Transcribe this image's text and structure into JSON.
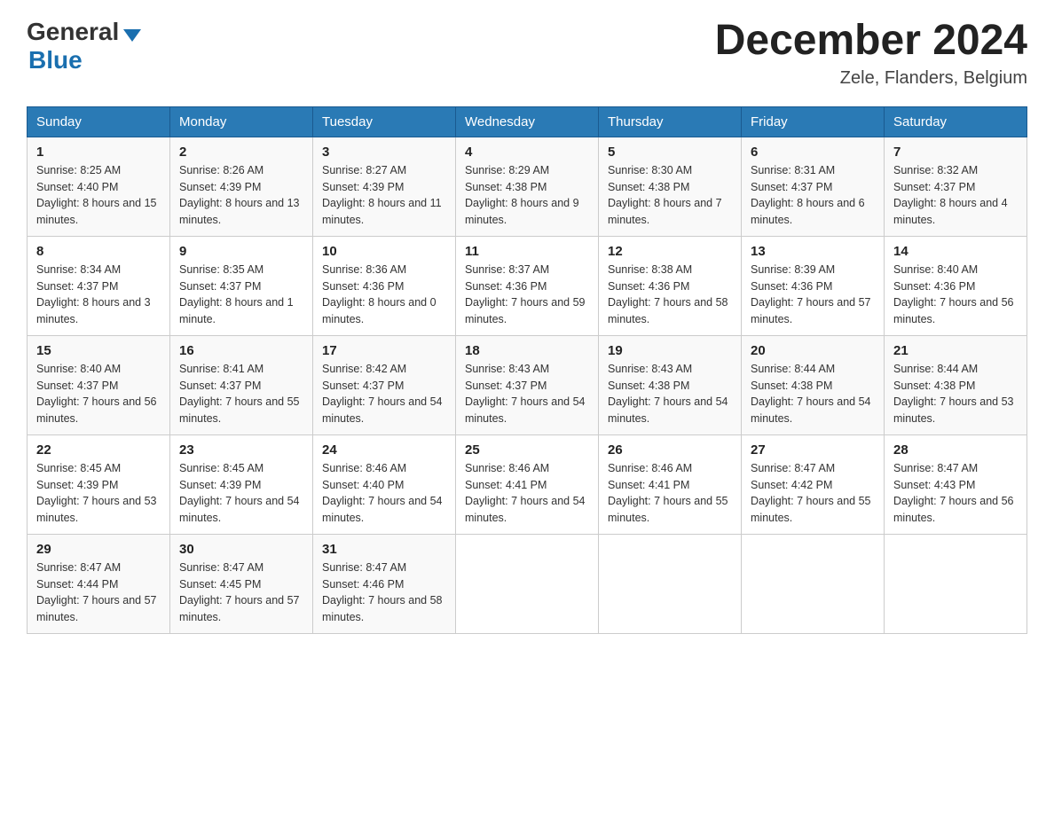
{
  "header": {
    "logo_general": "General",
    "logo_blue": "Blue",
    "month_year": "December 2024",
    "location": "Zele, Flanders, Belgium"
  },
  "days_of_week": [
    "Sunday",
    "Monday",
    "Tuesday",
    "Wednesday",
    "Thursday",
    "Friday",
    "Saturday"
  ],
  "weeks": [
    [
      {
        "day": "1",
        "sunrise": "8:25 AM",
        "sunset": "4:40 PM",
        "daylight": "8 hours and 15 minutes."
      },
      {
        "day": "2",
        "sunrise": "8:26 AM",
        "sunset": "4:39 PM",
        "daylight": "8 hours and 13 minutes."
      },
      {
        "day": "3",
        "sunrise": "8:27 AM",
        "sunset": "4:39 PM",
        "daylight": "8 hours and 11 minutes."
      },
      {
        "day": "4",
        "sunrise": "8:29 AM",
        "sunset": "4:38 PM",
        "daylight": "8 hours and 9 minutes."
      },
      {
        "day": "5",
        "sunrise": "8:30 AM",
        "sunset": "4:38 PM",
        "daylight": "8 hours and 7 minutes."
      },
      {
        "day": "6",
        "sunrise": "8:31 AM",
        "sunset": "4:37 PM",
        "daylight": "8 hours and 6 minutes."
      },
      {
        "day": "7",
        "sunrise": "8:32 AM",
        "sunset": "4:37 PM",
        "daylight": "8 hours and 4 minutes."
      }
    ],
    [
      {
        "day": "8",
        "sunrise": "8:34 AM",
        "sunset": "4:37 PM",
        "daylight": "8 hours and 3 minutes."
      },
      {
        "day": "9",
        "sunrise": "8:35 AM",
        "sunset": "4:37 PM",
        "daylight": "8 hours and 1 minute."
      },
      {
        "day": "10",
        "sunrise": "8:36 AM",
        "sunset": "4:36 PM",
        "daylight": "8 hours and 0 minutes."
      },
      {
        "day": "11",
        "sunrise": "8:37 AM",
        "sunset": "4:36 PM",
        "daylight": "7 hours and 59 minutes."
      },
      {
        "day": "12",
        "sunrise": "8:38 AM",
        "sunset": "4:36 PM",
        "daylight": "7 hours and 58 minutes."
      },
      {
        "day": "13",
        "sunrise": "8:39 AM",
        "sunset": "4:36 PM",
        "daylight": "7 hours and 57 minutes."
      },
      {
        "day": "14",
        "sunrise": "8:40 AM",
        "sunset": "4:36 PM",
        "daylight": "7 hours and 56 minutes."
      }
    ],
    [
      {
        "day": "15",
        "sunrise": "8:40 AM",
        "sunset": "4:37 PM",
        "daylight": "7 hours and 56 minutes."
      },
      {
        "day": "16",
        "sunrise": "8:41 AM",
        "sunset": "4:37 PM",
        "daylight": "7 hours and 55 minutes."
      },
      {
        "day": "17",
        "sunrise": "8:42 AM",
        "sunset": "4:37 PM",
        "daylight": "7 hours and 54 minutes."
      },
      {
        "day": "18",
        "sunrise": "8:43 AM",
        "sunset": "4:37 PM",
        "daylight": "7 hours and 54 minutes."
      },
      {
        "day": "19",
        "sunrise": "8:43 AM",
        "sunset": "4:38 PM",
        "daylight": "7 hours and 54 minutes."
      },
      {
        "day": "20",
        "sunrise": "8:44 AM",
        "sunset": "4:38 PM",
        "daylight": "7 hours and 54 minutes."
      },
      {
        "day": "21",
        "sunrise": "8:44 AM",
        "sunset": "4:38 PM",
        "daylight": "7 hours and 53 minutes."
      }
    ],
    [
      {
        "day": "22",
        "sunrise": "8:45 AM",
        "sunset": "4:39 PM",
        "daylight": "7 hours and 53 minutes."
      },
      {
        "day": "23",
        "sunrise": "8:45 AM",
        "sunset": "4:39 PM",
        "daylight": "7 hours and 54 minutes."
      },
      {
        "day": "24",
        "sunrise": "8:46 AM",
        "sunset": "4:40 PM",
        "daylight": "7 hours and 54 minutes."
      },
      {
        "day": "25",
        "sunrise": "8:46 AM",
        "sunset": "4:41 PM",
        "daylight": "7 hours and 54 minutes."
      },
      {
        "day": "26",
        "sunrise": "8:46 AM",
        "sunset": "4:41 PM",
        "daylight": "7 hours and 55 minutes."
      },
      {
        "day": "27",
        "sunrise": "8:47 AM",
        "sunset": "4:42 PM",
        "daylight": "7 hours and 55 minutes."
      },
      {
        "day": "28",
        "sunrise": "8:47 AM",
        "sunset": "4:43 PM",
        "daylight": "7 hours and 56 minutes."
      }
    ],
    [
      {
        "day": "29",
        "sunrise": "8:47 AM",
        "sunset": "4:44 PM",
        "daylight": "7 hours and 57 minutes."
      },
      {
        "day": "30",
        "sunrise": "8:47 AM",
        "sunset": "4:45 PM",
        "daylight": "7 hours and 57 minutes."
      },
      {
        "day": "31",
        "sunrise": "8:47 AM",
        "sunset": "4:46 PM",
        "daylight": "7 hours and 58 minutes."
      },
      null,
      null,
      null,
      null
    ]
  ]
}
